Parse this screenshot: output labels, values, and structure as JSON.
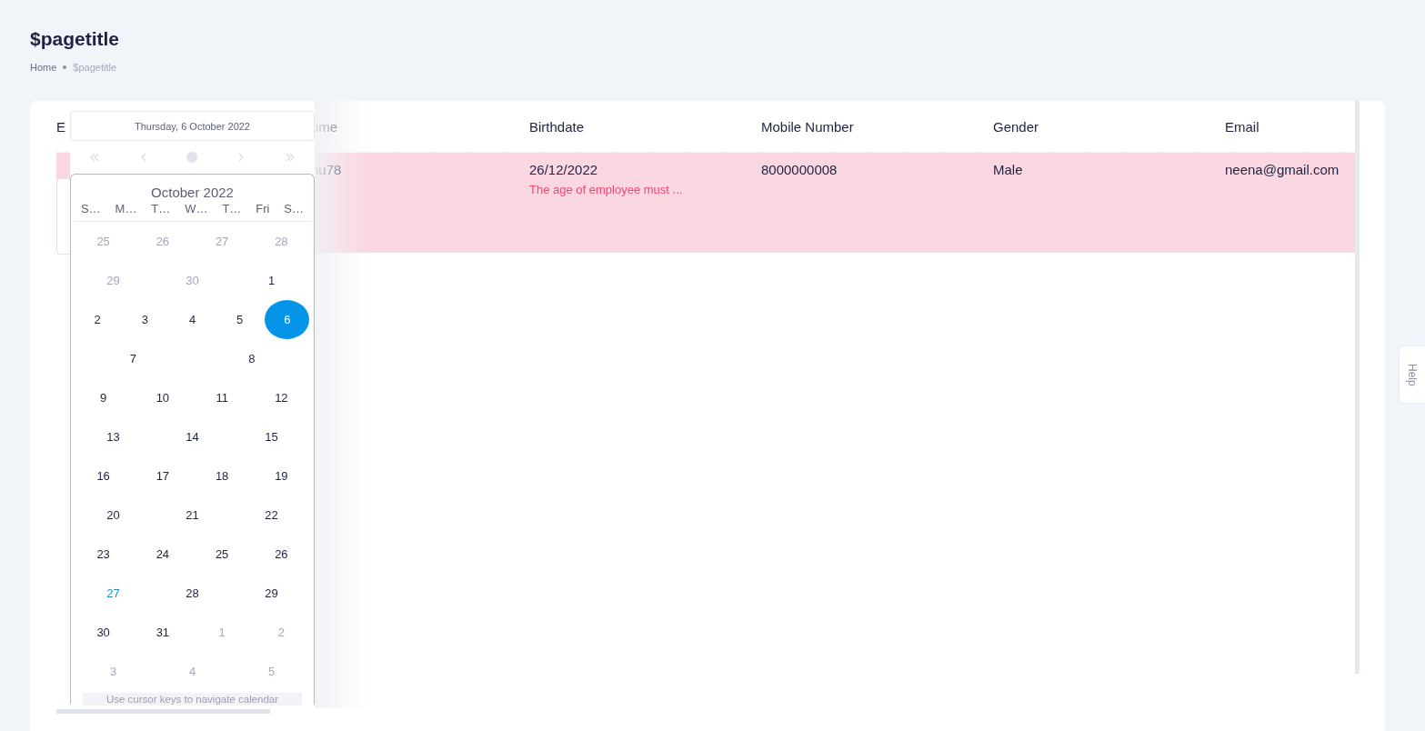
{
  "page": {
    "title": "$pagetitle",
    "breadcrumb": [
      {
        "text": "Home",
        "current": false
      },
      {
        "text": "$pagetitle",
        "current": true
      }
    ]
  },
  "table": {
    "columns": [
      "E",
      "ume",
      "Birthdate",
      "Mobile Number",
      "Gender",
      "Email"
    ],
    "rows": [
      {
        "invalid": true,
        "cells": [
          {
            "kind": "input"
          },
          {
            "kind": "text",
            "text": "nu78"
          },
          {
            "kind": "text",
            "text": "26/12/2022",
            "error": "The age of employee must ..."
          },
          {
            "kind": "text",
            "text": "8000000008"
          },
          {
            "kind": "text",
            "text": "Male"
          },
          {
            "kind": "text",
            "text": "neena@gmail.com"
          }
        ]
      }
    ]
  },
  "datepicker": {
    "date_header": "Thursday, 6 October 2022",
    "month_title": "October 2022",
    "weekdays": [
      "S…",
      "M…",
      "T…",
      "W…",
      "T…",
      "Fri",
      "S…"
    ],
    "weeks": [
      [
        {
          "text": "25",
          "outside": true,
          "selected": false,
          "today": false
        },
        {
          "text": "26",
          "outside": true,
          "selected": false,
          "today": false
        },
        {
          "text": "27",
          "outside": true,
          "selected": false,
          "today": false
        },
        {
          "text": "28",
          "outside": true,
          "selected": false,
          "today": false
        }
      ],
      [
        {
          "text": "29",
          "outside": true,
          "selected": false,
          "today": false
        },
        {
          "text": "30",
          "outside": true,
          "selected": false,
          "today": false
        },
        {
          "text": "1",
          "outside": false,
          "selected": false,
          "today": false
        }
      ],
      [
        {
          "text": "2",
          "outside": false,
          "selected": false,
          "today": false
        },
        {
          "text": "3",
          "outside": false,
          "selected": false,
          "today": false
        },
        {
          "text": "4",
          "outside": false,
          "selected": false,
          "today": false
        },
        {
          "text": "5",
          "outside": false,
          "selected": false,
          "today": false
        },
        {
          "text": "6",
          "outside": false,
          "selected": true,
          "today": false
        }
      ],
      [
        {
          "text": "7",
          "outside": false,
          "selected": false,
          "today": false
        },
        {
          "text": "8",
          "outside": false,
          "selected": false,
          "today": false
        }
      ],
      [
        {
          "text": "9",
          "outside": false,
          "selected": false,
          "today": false
        },
        {
          "text": "10",
          "outside": false,
          "selected": false,
          "today": false
        },
        {
          "text": "11",
          "outside": false,
          "selected": false,
          "today": false
        },
        {
          "text": "12",
          "outside": false,
          "selected": false,
          "today": false
        }
      ],
      [
        {
          "text": "13",
          "outside": false,
          "selected": false,
          "today": false
        },
        {
          "text": "14",
          "outside": false,
          "selected": false,
          "today": false
        },
        {
          "text": "15",
          "outside": false,
          "selected": false,
          "today": false
        }
      ],
      [
        {
          "text": "16",
          "outside": false,
          "selected": false,
          "today": false
        },
        {
          "text": "17",
          "outside": false,
          "selected": false,
          "today": false
        },
        {
          "text": "18",
          "outside": false,
          "selected": false,
          "today": false
        },
        {
          "text": "19",
          "outside": false,
          "selected": false,
          "today": false
        }
      ],
      [
        {
          "text": "20",
          "outside": false,
          "selected": false,
          "today": false
        },
        {
          "text": "21",
          "outside": false,
          "selected": false,
          "today": false
        },
        {
          "text": "22",
          "outside": false,
          "selected": false,
          "today": false
        }
      ],
      [
        {
          "text": "23",
          "outside": false,
          "selected": false,
          "today": false
        },
        {
          "text": "24",
          "outside": false,
          "selected": false,
          "today": false
        },
        {
          "text": "25",
          "outside": false,
          "selected": false,
          "today": false
        },
        {
          "text": "26",
          "outside": false,
          "selected": false,
          "today": false
        }
      ],
      [
        {
          "text": "27",
          "outside": false,
          "selected": false,
          "today": true
        },
        {
          "text": "28",
          "outside": false,
          "selected": false,
          "today": false
        },
        {
          "text": "29",
          "outside": false,
          "selected": false,
          "today": false
        }
      ],
      [
        {
          "text": "30",
          "outside": false,
          "selected": false,
          "today": false
        },
        {
          "text": "31",
          "outside": false,
          "selected": false,
          "today": false
        },
        {
          "text": "1",
          "outside": true,
          "selected": false,
          "today": false
        },
        {
          "text": "2",
          "outside": true,
          "selected": false,
          "today": false
        }
      ],
      [
        {
          "text": "3",
          "outside": true,
          "selected": false,
          "today": false
        },
        {
          "text": "4",
          "outside": true,
          "selected": false,
          "today": false
        },
        {
          "text": "5",
          "outside": true,
          "selected": false,
          "today": false
        }
      ]
    ],
    "footer": "Use cursor keys to navigate calendar"
  },
  "help_tab": {
    "label": "Help"
  }
}
